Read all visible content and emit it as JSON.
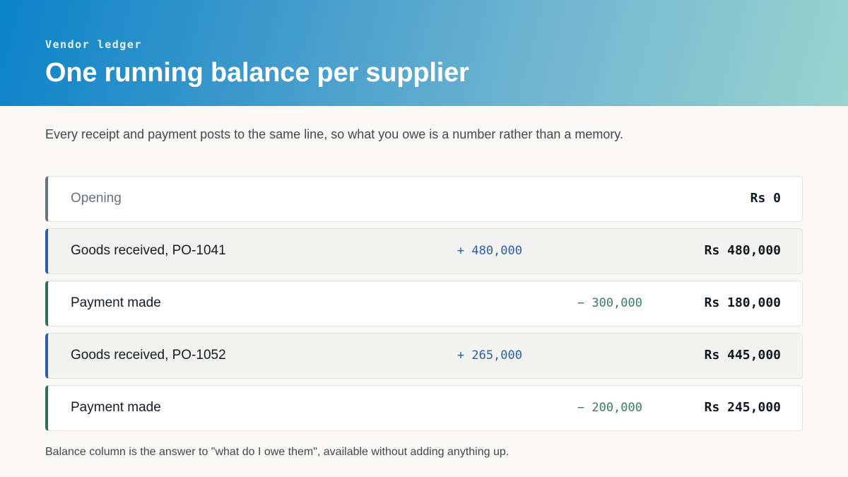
{
  "header": {
    "eyebrow": "Vendor ledger",
    "title": "One running balance per supplier"
  },
  "intro": "Every receipt and payment posts to the same line, so what you owe is a number rather than a memory.",
  "ledger": {
    "rows": [
      {
        "type": "opening",
        "description": "Opening",
        "received": "",
        "paid": "",
        "balance": "Rs 0"
      },
      {
        "type": "receipt",
        "description": "Goods received, PO-1041",
        "received": "+ 480,000",
        "paid": "",
        "balance": "Rs 480,000"
      },
      {
        "type": "payment",
        "description": "Payment made",
        "received": "",
        "paid": "− 300,000",
        "balance": "Rs 180,000"
      },
      {
        "type": "receipt",
        "description": "Goods received, PO-1052",
        "received": "+ 265,000",
        "paid": "",
        "balance": "Rs 445,000"
      },
      {
        "type": "payment",
        "description": "Payment made",
        "received": "",
        "paid": "− 200,000",
        "balance": "Rs 245,000"
      }
    ]
  },
  "footnote": "Balance column is the answer to \"what do I owe them\", available without adding anything up.",
  "colors": {
    "receipt_accent": "#2e5ca8",
    "payment_accent": "#2f6e58",
    "opening_accent": "#6b7178",
    "header_gradient_start": "#0a83c8",
    "header_gradient_end": "#9ad4d0"
  }
}
